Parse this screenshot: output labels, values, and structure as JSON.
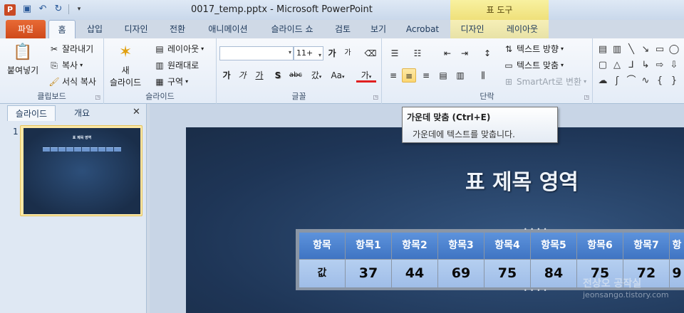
{
  "window": {
    "title": "0017_temp.pptx  -  Microsoft PowerPoint",
    "context_tool_title": "표 도구"
  },
  "tabs": [
    {
      "label": "파일"
    },
    {
      "label": "홈"
    },
    {
      "label": "삽입"
    },
    {
      "label": "디자인"
    },
    {
      "label": "전환"
    },
    {
      "label": "애니메이션"
    },
    {
      "label": "슬라이드 쇼"
    },
    {
      "label": "검토"
    },
    {
      "label": "보기"
    },
    {
      "label": "Acrobat"
    },
    {
      "label": "디자인"
    },
    {
      "label": "레이아웃"
    }
  ],
  "ribbon": {
    "clipboard": {
      "paste": "붙여넣기",
      "cut": "잘라내기",
      "copy": "복사",
      "format_painter": "서식 복사",
      "label": "클립보드"
    },
    "slides": {
      "new_slide_line1": "새",
      "new_slide_line2": "슬라이드",
      "layout": "레이아웃",
      "reset": "원래대로",
      "section": "구역",
      "label": "슬라이드"
    },
    "font": {
      "font_name": "",
      "font_size": "11+",
      "label": "글꼴",
      "bold_glyph": "가",
      "italic_glyph": "가",
      "underline_glyph": "가",
      "shadow_glyph": "S",
      "strike_glyph": "abc",
      "spacing_glyph": "갔",
      "case_glyph": "Aa",
      "color_glyph": "가",
      "grow_glyph": "가",
      "shrink_glyph": "가"
    },
    "paragraph": {
      "text_direction": "텍스트 방향",
      "align_text": "텍스트 맞춤",
      "smartart": "SmartArt로 변환",
      "label": "단락"
    }
  },
  "left_panel": {
    "tab_slides": "슬라이드",
    "tab_outline": "개요",
    "slide_number": "1",
    "thumb_title": "표 제목 영역"
  },
  "slide": {
    "title": "표 제목 영역",
    "table": {
      "headers": [
        "항목",
        "항목1",
        "항목2",
        "항목3",
        "항목4",
        "항목5",
        "항목6",
        "항목7",
        "항"
      ],
      "values": [
        "값",
        "37",
        "44",
        "69",
        "75",
        "84",
        "75",
        "72",
        "9"
      ]
    }
  },
  "tooltip": {
    "title": "가운데 맞춤 (Ctrl+E)",
    "description": "가운데에 텍스트를 맞춥니다."
  },
  "watermark": {
    "line1": "전상오 공작실",
    "line2": "jeonsango.tistory.com"
  }
}
